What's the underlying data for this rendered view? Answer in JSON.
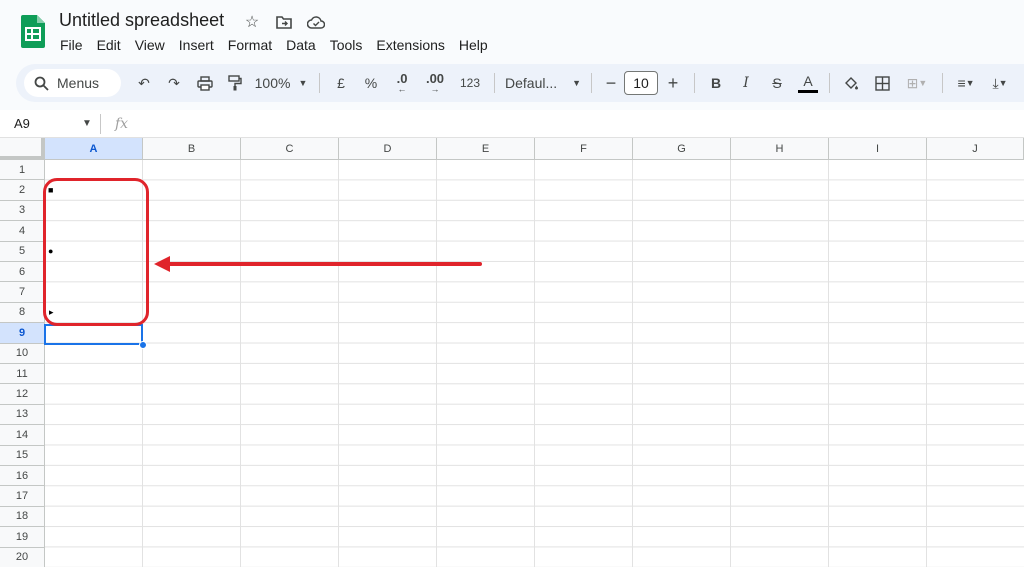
{
  "doc": {
    "title": "Untitled spreadsheet"
  },
  "title_icons": [
    "star-icon",
    "move-folder-icon",
    "cloud-status-icon"
  ],
  "menu": [
    "File",
    "Edit",
    "View",
    "Insert",
    "Format",
    "Data",
    "Tools",
    "Extensions",
    "Help"
  ],
  "toolbar": {
    "search_label": "Menus",
    "zoom": "100%",
    "currency": "£",
    "percent": "%",
    "dec_decrease": ".0",
    "dec_increase": ".00",
    "number_format": "123",
    "font": "Defaul...",
    "font_size": "10",
    "bold": "B",
    "italic": "I",
    "text_color_letter": "A"
  },
  "formula_bar": {
    "cell_ref": "A9",
    "fx": "fx"
  },
  "columns": [
    "A",
    "B",
    "C",
    "D",
    "E",
    "F",
    "G",
    "H",
    "I",
    "J"
  ],
  "rows": [
    "1",
    "2",
    "3",
    "4",
    "5",
    "6",
    "7",
    "8",
    "9",
    "10",
    "11",
    "12",
    "13",
    "14",
    "15",
    "16",
    "17",
    "18",
    "19",
    "20"
  ],
  "selected": {
    "column": "A",
    "row": "9"
  },
  "cells": [
    {
      "ref": "A2",
      "value": "■"
    },
    {
      "ref": "A5",
      "value": "●"
    },
    {
      "ref": "A8",
      "value": "▸"
    }
  ],
  "colors": {
    "annotation": "#e0242b",
    "selection": "#1a73e8",
    "sheets_green": "#0f9d58"
  }
}
